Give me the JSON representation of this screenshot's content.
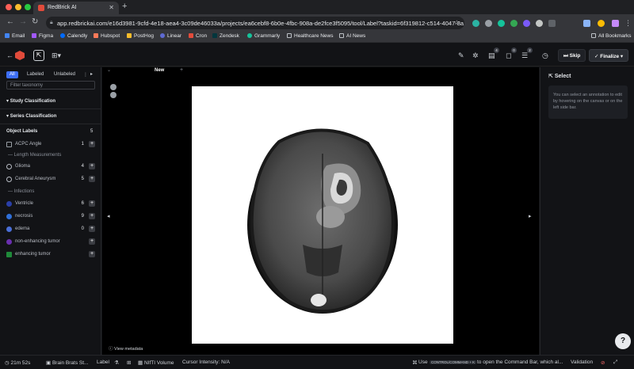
{
  "browser": {
    "tab_title": "RedBrick AI",
    "url": "app.redbrickai.com/e16d3981-9cfd-4e18-aea4-3c09de46033a/projects/ea6cebf8-6b0e-4fbc-908a-de2fce3f5095/tool/Label?taskid=6f319812-c514-4047-8a...",
    "bookmarks": [
      "Email",
      "Figma",
      "Calendly",
      "Hubspot",
      "PostHog",
      "Linear",
      "Cron",
      "Zendesk",
      "Grammarly",
      "Healthcare News",
      "AI News"
    ],
    "all_bookmarks": "All Bookmarks"
  },
  "header": {
    "skip_label": "Skip",
    "finalize_label": "Finalize",
    "badges": [
      "4",
      "0",
      "2"
    ]
  },
  "left_panel": {
    "tabs": [
      "All",
      "Labeled",
      "Unlabeled",
      "⋮"
    ],
    "filter_placeholder": "Filter taxonomy",
    "sections": [
      "Study Classification",
      "Series Classification"
    ],
    "object_labels_title": "Object Labels",
    "object_labels_count": "5",
    "items": [
      {
        "name": "ACPC Angle",
        "count": "1"
      },
      {
        "group": "Length Measurements"
      },
      {
        "name": "Glioma",
        "count": "4"
      },
      {
        "name": "Cerebral Aneurysm",
        "count": "5"
      },
      {
        "group": "Infections"
      },
      {
        "name": "Ventricle",
        "count": "6"
      },
      {
        "name": "necrosis",
        "count": "9"
      },
      {
        "name": "edema",
        "count": "0"
      },
      {
        "name": "non-enhancing tumor",
        "count": ""
      },
      {
        "name": "enhancing tumor",
        "count": ""
      }
    ]
  },
  "viewer": {
    "view_label": "New",
    "overlay_bottom": "View metadata"
  },
  "right_panel": {
    "title": "Select",
    "hint": "You can select an annotation to edit by hovering on the canvas or on the left side bar."
  },
  "status_bar": {
    "timer": "21m 52s",
    "task_name": "Brain Brats St...",
    "tool": "Label",
    "format": "NIfTI Volume",
    "cursor": "Cursor Intensity: N/A",
    "use": "Use",
    "shortcut": "CONTROL/COMMAND + K",
    "command_hint": "to open the Command Bar, which al...",
    "validation": "Validation"
  },
  "colors": {
    "accent": "#3d6ef5",
    "brand_red": "#e14b3b"
  }
}
